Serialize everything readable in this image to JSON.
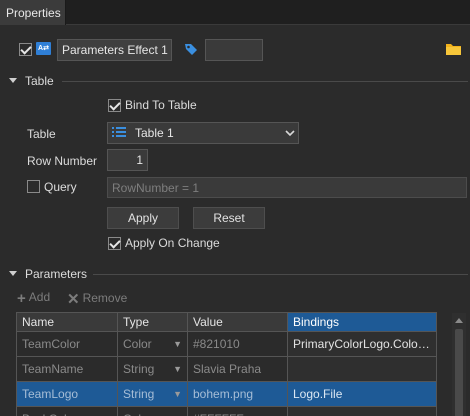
{
  "tabbar": {
    "tab_label": "Properties"
  },
  "header": {
    "enabled": true,
    "effect_name": "Parameters Effect 1",
    "tag_value": ""
  },
  "table_section": {
    "title": "Table",
    "bind_to_table_label": "Bind To Table",
    "bind_to_table_checked": true,
    "table_label": "Table",
    "table_value": "Table 1",
    "row_number_label": "Row Number",
    "row_number_value": "1",
    "query_label": "Query",
    "query_checked": false,
    "query_value": "RowNumber = 1",
    "apply_label": "Apply",
    "reset_label": "Reset",
    "apply_on_change_label": "Apply On Change",
    "apply_on_change_checked": true
  },
  "parameters_section": {
    "title": "Parameters",
    "add_label": "Add",
    "remove_label": "Remove",
    "columns": [
      "Name",
      "Type",
      "Value",
      "Bindings"
    ],
    "rows": [
      {
        "name": "TeamColor",
        "type": "Color",
        "value": "#821010",
        "binding": "PrimaryColorLogo.Color..."
      },
      {
        "name": "TeamName",
        "type": "String",
        "value": "Slavia Praha",
        "binding": ""
      },
      {
        "name": "TeamLogo",
        "type": "String",
        "value": "bohem.png",
        "binding": "Logo.File"
      },
      {
        "name": "BackColor",
        "type": "Color",
        "value": "#FFFFFF",
        "binding": ""
      }
    ]
  },
  "colors": {
    "background": "#2b2b2b",
    "selection": "#1e5a96",
    "folder_icon": "#f2b21b",
    "tag_icon": "#3a8fe0"
  }
}
